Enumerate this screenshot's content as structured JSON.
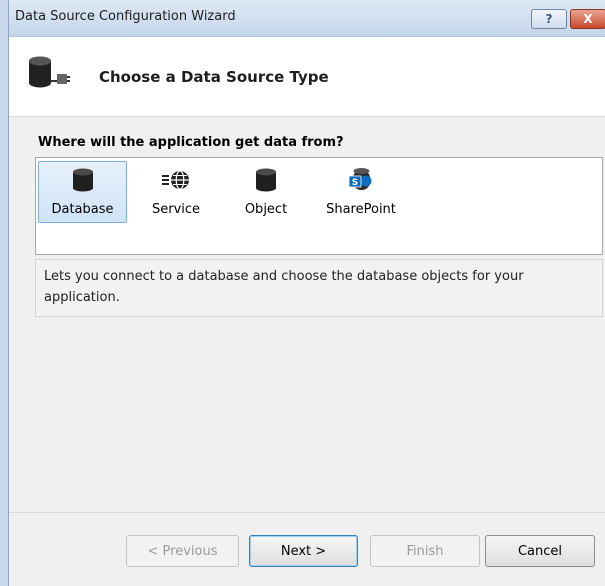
{
  "window": {
    "title": "Data Source Configuration Wizard",
    "help_label": "?",
    "close_label": "X"
  },
  "header": {
    "title": "Choose a Data Source Type"
  },
  "main": {
    "question": "Where will the application get data from?",
    "types": [
      {
        "label": "Database",
        "icon": "database-icon",
        "selected": true
      },
      {
        "label": "Service",
        "icon": "service-globe-icon",
        "selected": false
      },
      {
        "label": "Object",
        "icon": "object-cylinder-icon",
        "selected": false
      },
      {
        "label": "SharePoint",
        "icon": "sharepoint-icon",
        "selected": false
      }
    ],
    "description": "Lets you connect to a database and choose the database objects for your application."
  },
  "buttons": {
    "previous": "< Previous",
    "next": "Next >",
    "finish": "Finish",
    "cancel": "Cancel"
  },
  "colors": {
    "selection_border": "#84acd9",
    "selection_fill": "#dbe9f8",
    "sharepoint_blue": "#0a6ebd"
  }
}
